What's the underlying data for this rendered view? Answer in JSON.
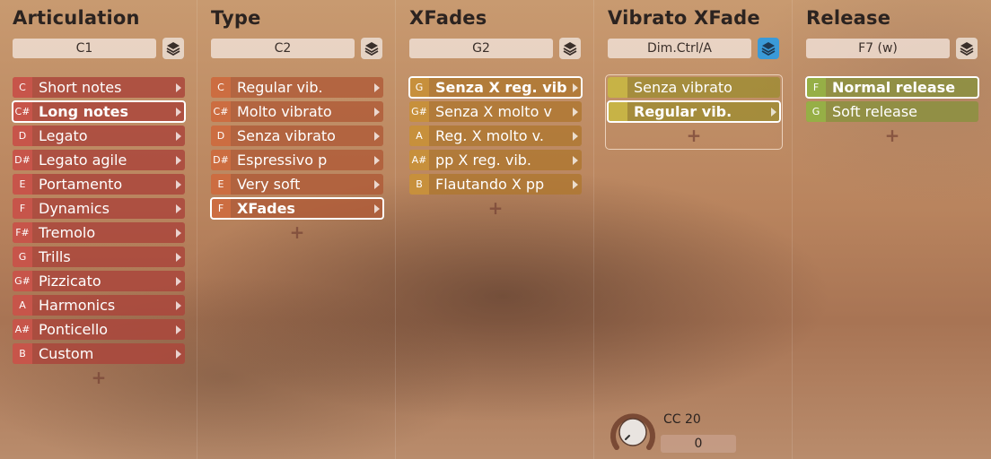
{
  "columns": [
    {
      "title": "Articulation",
      "selector": "C1",
      "items": [
        {
          "key": "C",
          "label": "Short notes"
        },
        {
          "key": "C#",
          "label": "Long notes"
        },
        {
          "key": "D",
          "label": "Legato"
        },
        {
          "key": "D#",
          "label": "Legato agile"
        },
        {
          "key": "E",
          "label": "Portamento"
        },
        {
          "key": "F",
          "label": "Dynamics"
        },
        {
          "key": "F#",
          "label": "Tremolo"
        },
        {
          "key": "G",
          "label": "Trills"
        },
        {
          "key": "G#",
          "label": "Pizzicato"
        },
        {
          "key": "A",
          "label": "Harmonics"
        },
        {
          "key": "A#",
          "label": "Ponticello"
        },
        {
          "key": "B",
          "label": "Custom"
        }
      ],
      "add": "+"
    },
    {
      "title": "Type",
      "selector": "C2",
      "items": [
        {
          "key": "C",
          "label": "Regular vib."
        },
        {
          "key": "C#",
          "label": "Molto vibrato"
        },
        {
          "key": "D",
          "label": "Senza vibrato"
        },
        {
          "key": "D#",
          "label": "Espressivo p"
        },
        {
          "key": "E",
          "label": "Very soft"
        },
        {
          "key": "F",
          "label": "XFades"
        }
      ],
      "add": "+"
    },
    {
      "title": "XFades",
      "selector": "G2",
      "items": [
        {
          "key": "G",
          "label": "Senza X reg. vib"
        },
        {
          "key": "G#",
          "label": "Senza X molto v"
        },
        {
          "key": "A",
          "label": "Reg. X molto v."
        },
        {
          "key": "A#",
          "label": "pp X reg. vib."
        },
        {
          "key": "B",
          "label": "Flautando X pp"
        }
      ],
      "add": "+"
    },
    {
      "title": "Vibrato XFade",
      "selector": "Dim.Ctrl/A",
      "items": [
        {
          "key": "",
          "label": "Senza vibrato"
        },
        {
          "key": "",
          "label": "Regular vib."
        }
      ],
      "add": "+",
      "knob": {
        "label": "CC 20",
        "value": "0"
      }
    },
    {
      "title": "Release",
      "selector": "F7 (w)",
      "items": [
        {
          "key": "F",
          "label": "Normal release"
        },
        {
          "key": "G",
          "label": "Soft release"
        }
      ],
      "add": "+"
    }
  ],
  "icons": {
    "layers": "layers-icon",
    "add": "plus-icon",
    "arrow": "chevron-right-icon",
    "knob": "knob-icon"
  },
  "colors": {
    "active_button": "#3a9ad8",
    "articulation": "#aa463c",
    "type": "#af5a37",
    "xfades": "#af7832",
    "vibrato": "#a08c37",
    "release": "#8c9141"
  }
}
